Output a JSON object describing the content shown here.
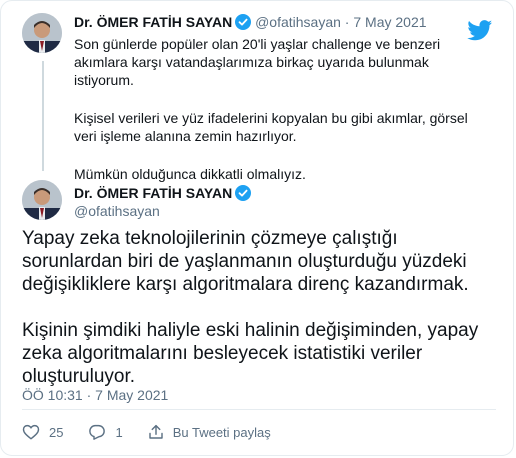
{
  "reply": {
    "display_name": "Dr. ÖMER FATİH SAYAN",
    "handle": "@ofatihsayan",
    "separator": "·",
    "date": "7 May 2021",
    "paragraphs": [
      "Son günlerde popüler olan 20'li yaşlar challenge ve benzeri akımlara karşı vatandaşlarımıza birkaç uyarıda bulunmak istiyorum.",
      "Kişisel verileri ve yüz ifadelerini kopyalan bu gibi akımlar, görsel veri işleme alanına zemin hazırlıyor.",
      "Mümkün olduğunca dikkatli olmalıyız."
    ]
  },
  "main": {
    "display_name": "Dr. ÖMER FATİH SAYAN",
    "handle": "@ofatihsayan",
    "paragraphs": [
      "Yapay zeka teknolojilerinin çözmeye çalıştığı sorunlardan biri de yaşlanmanın oluşturduğu yüzdeki değişikliklere karşı algoritmalara direnç kazandırmak.",
      "Kişinin şimdiki haliyle eski halinin değişiminden, yapay zeka algoritmalarını besleyecek istatistiki veriler oluşturuluyor."
    ],
    "timestamp": "ÖÖ 10:31 · 7 May 2021"
  },
  "actions": {
    "like_count": "25",
    "reply_count": "1",
    "share_label": "Bu Tweeti paylaş"
  },
  "icons": [
    "twitter-logo-icon",
    "verified-badge-icon",
    "heart-icon",
    "reply-icon",
    "share-icon"
  ],
  "colors": {
    "twitter_blue": "#1da1f2",
    "muted": "#5b7083",
    "text": "#0f1419"
  }
}
